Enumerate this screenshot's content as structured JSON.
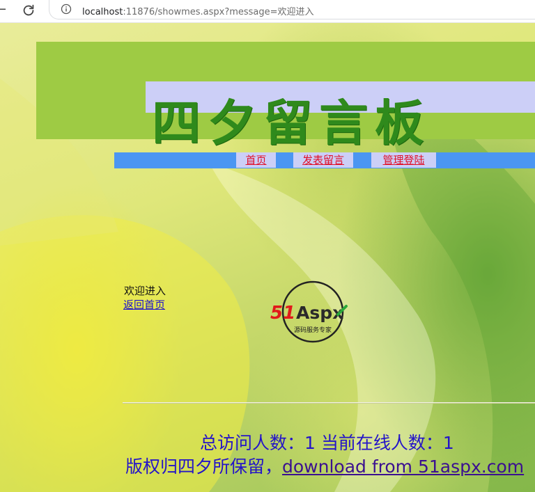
{
  "browser": {
    "url_host": "localhost",
    "url_rest": ":11876/showmes.aspx?message=欢迎进入"
  },
  "site": {
    "title": "四夕留言板"
  },
  "nav": {
    "items": [
      {
        "label": "首页"
      },
      {
        "label": "发表留言"
      },
      {
        "label": "管理登陆"
      }
    ]
  },
  "message": {
    "text": "欢迎进入",
    "return_link": "返回首页"
  },
  "logo": {
    "brand_red": "51",
    "brand_dark": "Aspx",
    "tagline": "源码服务专家"
  },
  "footer": {
    "stats": "总访问人数：1 当前在线人数：1",
    "copyright": "版权归四夕所保留，",
    "download_link": "download from 51aspx.com"
  },
  "colors": {
    "header_green": "#9ecb44",
    "header_lavender": "#cccff7",
    "nav_blue": "#4b96f2",
    "nav_link_red": "#e0102a",
    "title_green": "#2f8a1c",
    "footer_blue": "#2414c8"
  }
}
